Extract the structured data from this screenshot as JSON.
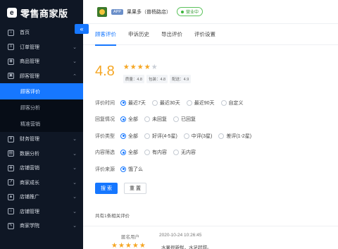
{
  "app": {
    "logo_text": "零售商家版",
    "logo_mark": "e"
  },
  "sidebar": {
    "collapse_icon": "«",
    "items": [
      {
        "label": "首页",
        "icon": "home-icon",
        "arrow": ""
      },
      {
        "label": "订单管理",
        "icon": "order-icon",
        "arrow": "⌄"
      },
      {
        "label": "商品管理",
        "icon": "goods-icon",
        "arrow": "⌄"
      },
      {
        "label": "顾客管理",
        "icon": "customer-icon",
        "arrow": "⌃"
      }
    ],
    "sub_items": [
      {
        "label": "顾客评价",
        "active": true
      },
      {
        "label": "顾客分析",
        "active": false
      },
      {
        "label": "精准营销",
        "active": false
      }
    ],
    "items_after": [
      {
        "label": "财务管理",
        "icon": "finance-icon",
        "arrow": "⌄"
      },
      {
        "label": "数据分析",
        "icon": "data-icon",
        "arrow": "⌄"
      },
      {
        "label": "店铺营销",
        "icon": "marketing-icon",
        "arrow": "⌄"
      },
      {
        "label": "商家成长",
        "icon": "growth-icon",
        "arrow": "⌄"
      },
      {
        "label": "店铺推广",
        "icon": "promotion-icon",
        "arrow": "⌄"
      },
      {
        "label": "店铺管理",
        "icon": "shop-icon",
        "arrow": "⌄"
      },
      {
        "label": "商家学院",
        "icon": "academy-icon",
        "arrow": "⌄"
      }
    ]
  },
  "header": {
    "badge": "APP",
    "store_name": "果果多（普杨路店）",
    "status": "营业中",
    "status_color": "#3bb53b"
  },
  "tabs": [
    {
      "label": "顾客评价",
      "active": true
    },
    {
      "label": "申诉历史",
      "active": false
    },
    {
      "label": "导出评价",
      "active": false
    },
    {
      "label": "评价设置",
      "active": false
    }
  ],
  "rating": {
    "score": "4.8",
    "stars_filled": 4,
    "stars_total": 5,
    "subscores": [
      "质量：4.8",
      "包装：4.8",
      "配送：4.9"
    ]
  },
  "filters": [
    {
      "label": "评价时间",
      "options": [
        "最近7天",
        "最近30天",
        "最近90天",
        "自定义"
      ],
      "selected": 0
    },
    {
      "label": "回复情况",
      "options": [
        "全部",
        "未回复",
        "已回复"
      ],
      "selected": 0
    },
    {
      "label": "评价类型",
      "options": [
        "全部",
        "好评(4-5星)",
        "中评(3星)",
        "差评(1-2星)"
      ],
      "selected": 0
    },
    {
      "label": "内容筛选",
      "options": [
        "全部",
        "有内容",
        "无内容"
      ],
      "selected": 0
    },
    {
      "label": "评价来源",
      "options": [
        "饿了么"
      ],
      "selected": 0
    }
  ],
  "buttons": {
    "search": "搜 索",
    "reset": "重 置"
  },
  "result_count": "共有1条相关评价",
  "review": {
    "user": "匿名用户",
    "time": "2020-10-24 10:26:45",
    "stars": "★★★★★",
    "text": "水果很新鲜，水足超甜。"
  },
  "colors": {
    "accent": "#1677ff",
    "star": "#f5a623",
    "sidebar_bg": "#0f1725"
  }
}
